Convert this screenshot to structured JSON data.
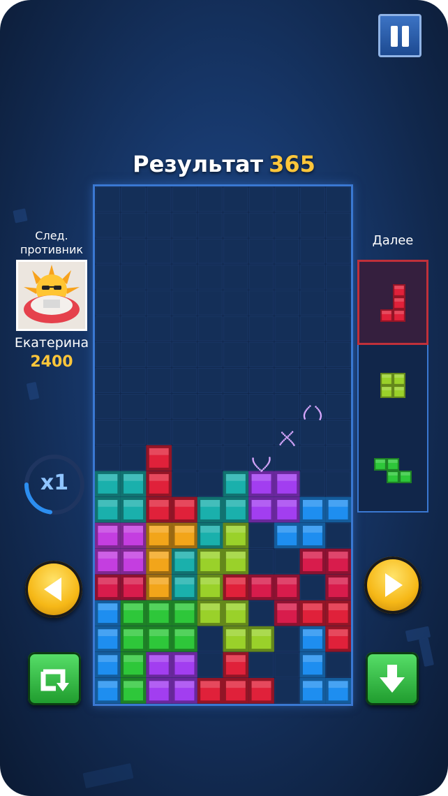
{
  "game": {
    "score_label": "Результат",
    "score_value": "365",
    "next_label": "Далее",
    "multiplier": "x1"
  },
  "opponent": {
    "label": "След. противник",
    "label_line1": "След.",
    "label_line2": "противник",
    "name": "Екатерина",
    "score": "2400"
  },
  "colors": {
    "C": "#1ab0ac",
    "R": "#e0213a",
    "O": "#f2a51a",
    "G": "#2ec73a",
    "L": "#9ad12a",
    "B": "#1e8ef0",
    "M": "#c43ee0",
    "P": "#a23ef0",
    "K": "#d81c4c",
    "grid": "#1a3868",
    "accent": "#ffc63a"
  },
  "board": {
    "cols": 10,
    "rows": 20,
    "grid": [
      "..........",
      "..........",
      "..........",
      "..........",
      "..........",
      "..........",
      "..........",
      "..........",
      "..........",
      "..........",
      "..R.......",
      "CCR..CPP..",
      "CCRRCCPPBB",
      "MMOOCL.BB.",
      "MMOCLL..KK",
      "KKOCLRKK.K",
      "BGGGLL.KRR",
      "BGGG.LL.BR",
      "BGPP.R..B.",
      "BGPPRRR.BB"
    ]
  },
  "next_queue": [
    {
      "shape": [
        ".R",
        ".R",
        "RR"
      ],
      "color": "R"
    },
    {
      "shape": [
        "LL",
        "LL"
      ],
      "color": "L"
    },
    {
      "shape": [
        "GG.",
        ".GG"
      ],
      "color": "G"
    }
  ],
  "controls": {
    "left": "move-left",
    "right": "move-right",
    "rotate": "rotate",
    "down": "drop-down"
  }
}
